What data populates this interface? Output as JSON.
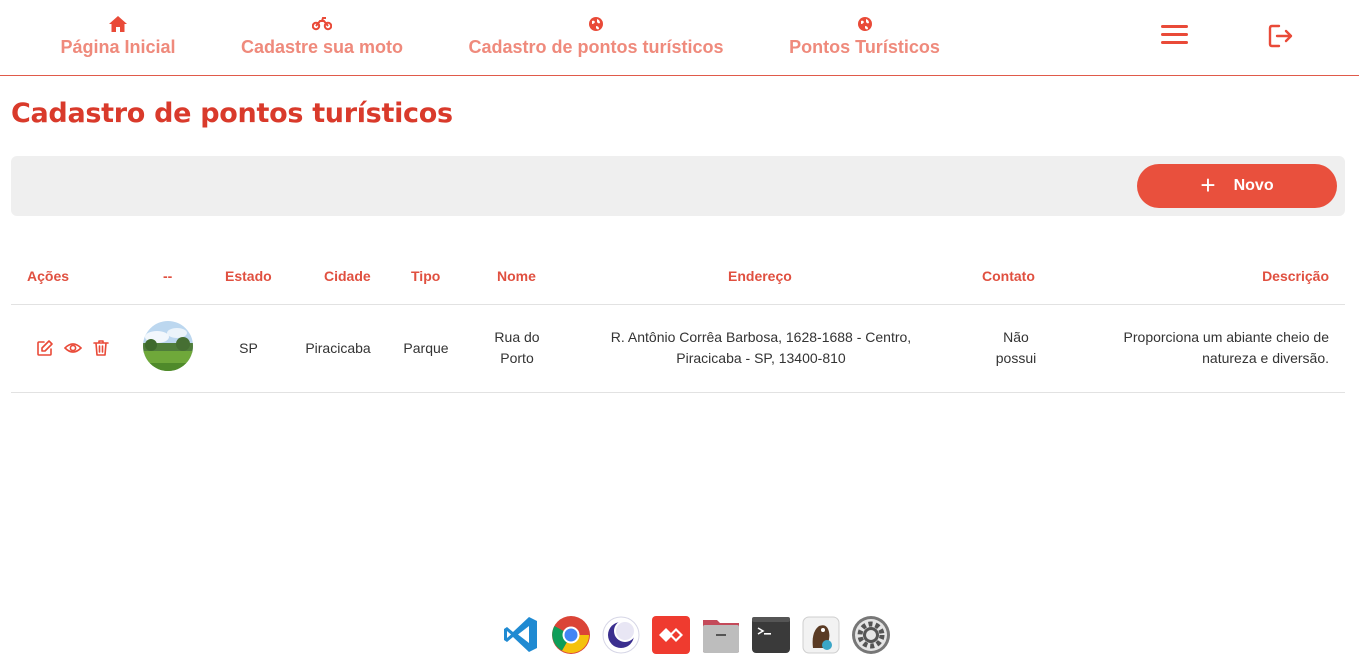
{
  "nav": {
    "items": [
      {
        "label": "Página Inicial",
        "icon": "house-icon"
      },
      {
        "label": "Cadastre sua moto",
        "icon": "motorcycle-icon"
      },
      {
        "label": "Cadastro de pontos turísticos",
        "icon": "globe-icon"
      },
      {
        "label": "Pontos Turísticos",
        "icon": "globe-icon"
      }
    ],
    "menu_icon": "hamburger-menu-icon",
    "logout_icon": "logout-icon"
  },
  "page": {
    "title": "Cadastro de pontos turísticos"
  },
  "toolbar": {
    "new_label": "Novo",
    "new_icon": "plus-icon"
  },
  "table": {
    "headers": {
      "acoes": "Ações",
      "image": "--",
      "estado": "Estado",
      "cidade": "Cidade",
      "tipo": "Tipo",
      "nome": "Nome",
      "endereco": "Endereço",
      "contato": "Contato",
      "descricao": "Descrição"
    },
    "rows": [
      {
        "actions": [
          "edit-icon",
          "view-eye-icon",
          "trash-icon"
        ],
        "estado": "SP",
        "cidade": "Piracicaba",
        "tipo": "Parque",
        "nome_1": "Rua do",
        "nome_2": "Porto",
        "endereco_1": "R. Antônio Corrêa Barbosa, 1628-1688 - Centro,",
        "endereco_2": "Piracicaba - SP, 13400-810",
        "contato_1": "Não",
        "contato_2": "possui",
        "descricao_1": "Proporciona um abiante cheio de",
        "descricao_2": "natureza e diversão."
      }
    ]
  },
  "dock": [
    "vscode-icon",
    "chrome-icon",
    "eclipse-icon",
    "anydesk-icon",
    "files-icon",
    "terminal-icon",
    "dbeaver-icon",
    "settings-icon"
  ],
  "colors": {
    "accent": "#e9503d",
    "nav_text": "#ef8a7c",
    "title": "#d93a2b"
  }
}
